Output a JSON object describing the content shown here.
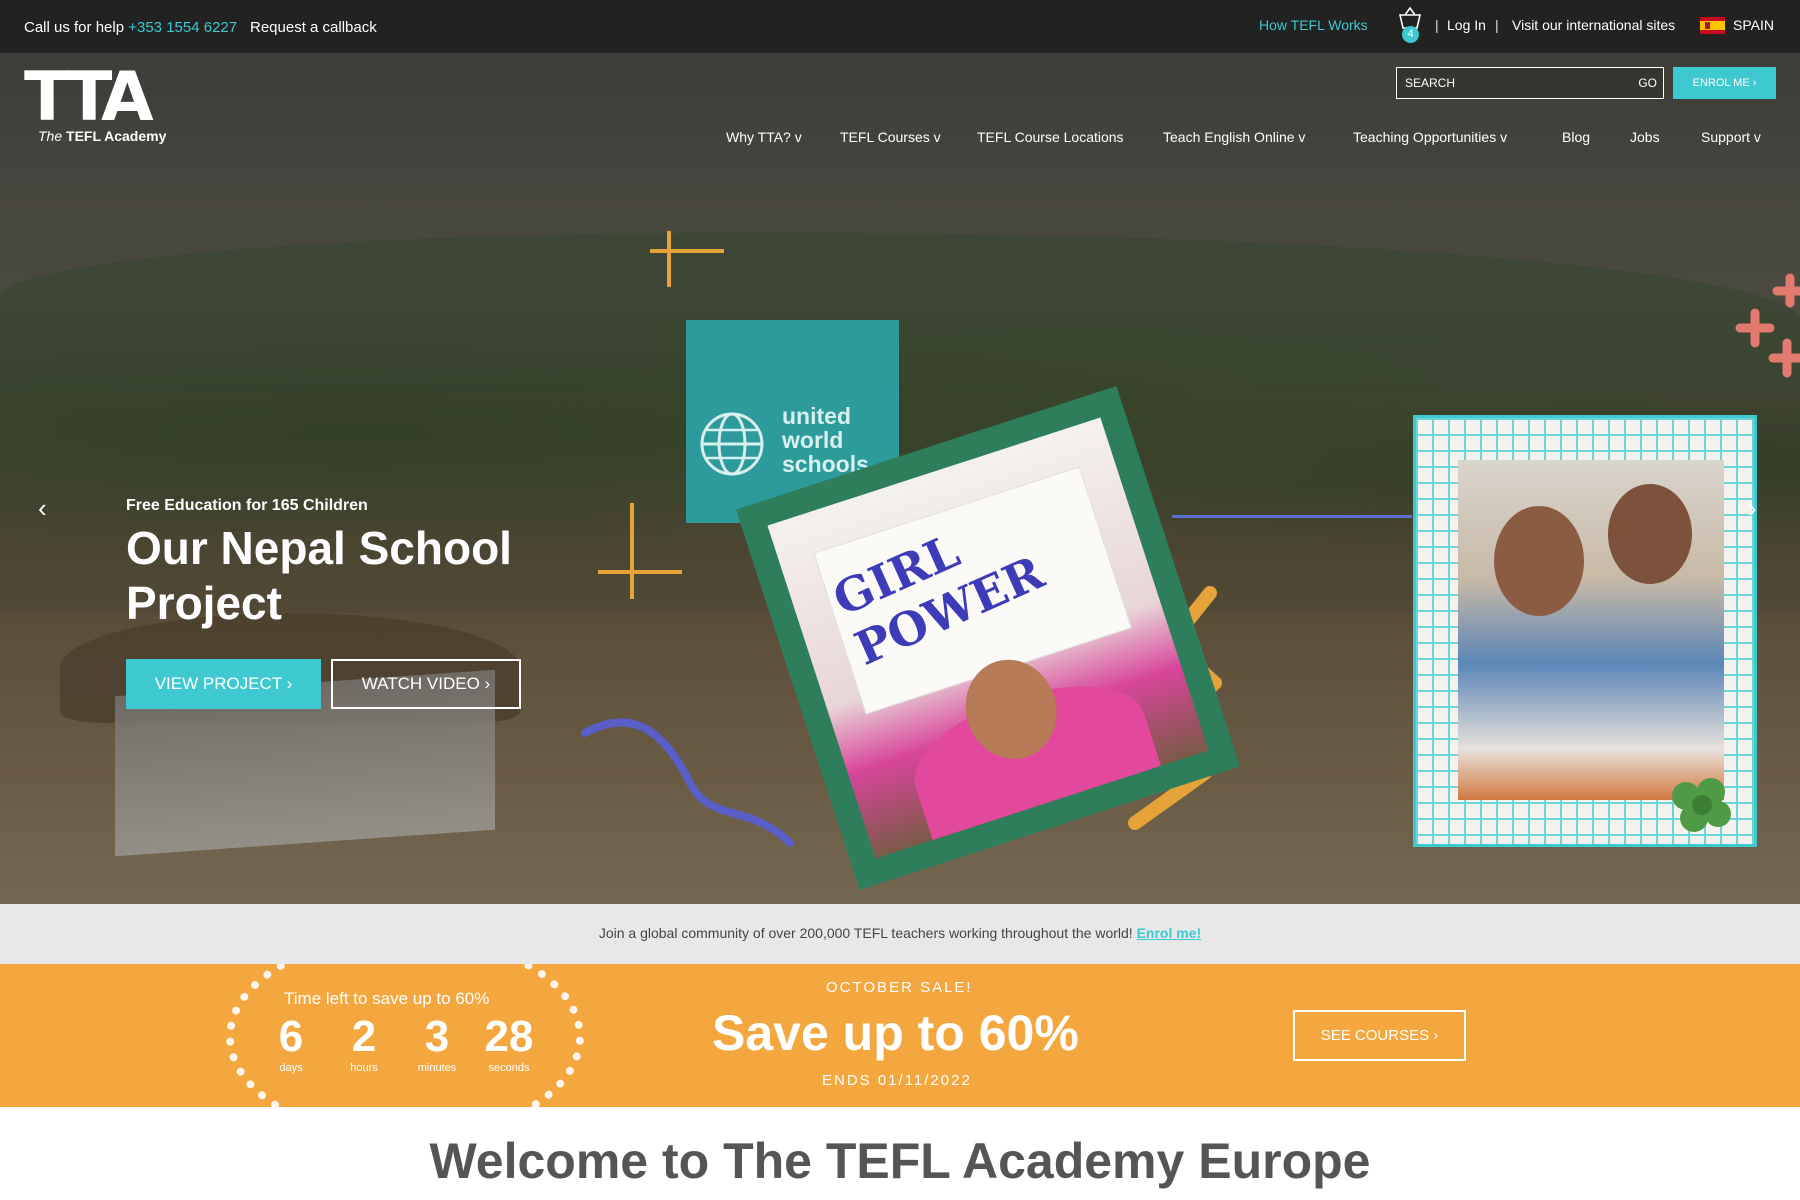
{
  "topbar": {
    "callus_label": "Call us for help",
    "phone": "+353 1554 6227",
    "callback": "Request a callback",
    "how_tefl_works": "How TEFL Works",
    "basket_count": "4",
    "separator": "|",
    "login": "Log In",
    "international": "Visit our international sites",
    "country": "SPAIN"
  },
  "logo": {
    "mark": "TTA",
    "tagline_italic": "The",
    "tagline": "TEFL Academy"
  },
  "search": {
    "placeholder": "SEARCH",
    "go": "GO"
  },
  "enrol_button": "ENROL ME ›",
  "nav": [
    {
      "label": "Why TTA? v"
    },
    {
      "label": "TEFL Courses v"
    },
    {
      "label": "TEFL Course Locations"
    },
    {
      "label": "Teach English Online v"
    },
    {
      "label": "Teaching Opportunities v"
    },
    {
      "label": "Blog"
    },
    {
      "label": "Jobs"
    },
    {
      "label": "Support v"
    }
  ],
  "hero": {
    "kicker": "Free Education for 165 Children",
    "title": "Our Nepal School Project",
    "view_project": "VIEW PROJECT ›",
    "watch_video": "WATCH VIDEO ›",
    "prev": "‹",
    "next": "›",
    "uws_line1": "united",
    "uws_line2": "world",
    "uws_line3": "schools",
    "sign_line1": "GIRL",
    "sign_line2": "POWER"
  },
  "strip": {
    "text": "Join a global community of over 200,000 TEFL teachers working throughout the world!",
    "link": "Enrol me!"
  },
  "sale": {
    "timer_label": "Time left to save up to 60%",
    "days": "6",
    "days_label": "days",
    "hours": "2",
    "hours_label": "hours",
    "minutes": "3",
    "minutes_label": "minutes",
    "seconds": "28",
    "seconds_label": "seconds",
    "kicker": "OCTOBER SALE!",
    "headline": "Save up to 60%",
    "ends": "ENDS 01/11/2022",
    "see_courses": "SEE COURSES ›"
  },
  "welcome": "Welcome to The TEFL Academy Europe",
  "colors": {
    "accent": "#3ec8cf",
    "sale": "#f5a73f",
    "topbar": "#222222"
  }
}
